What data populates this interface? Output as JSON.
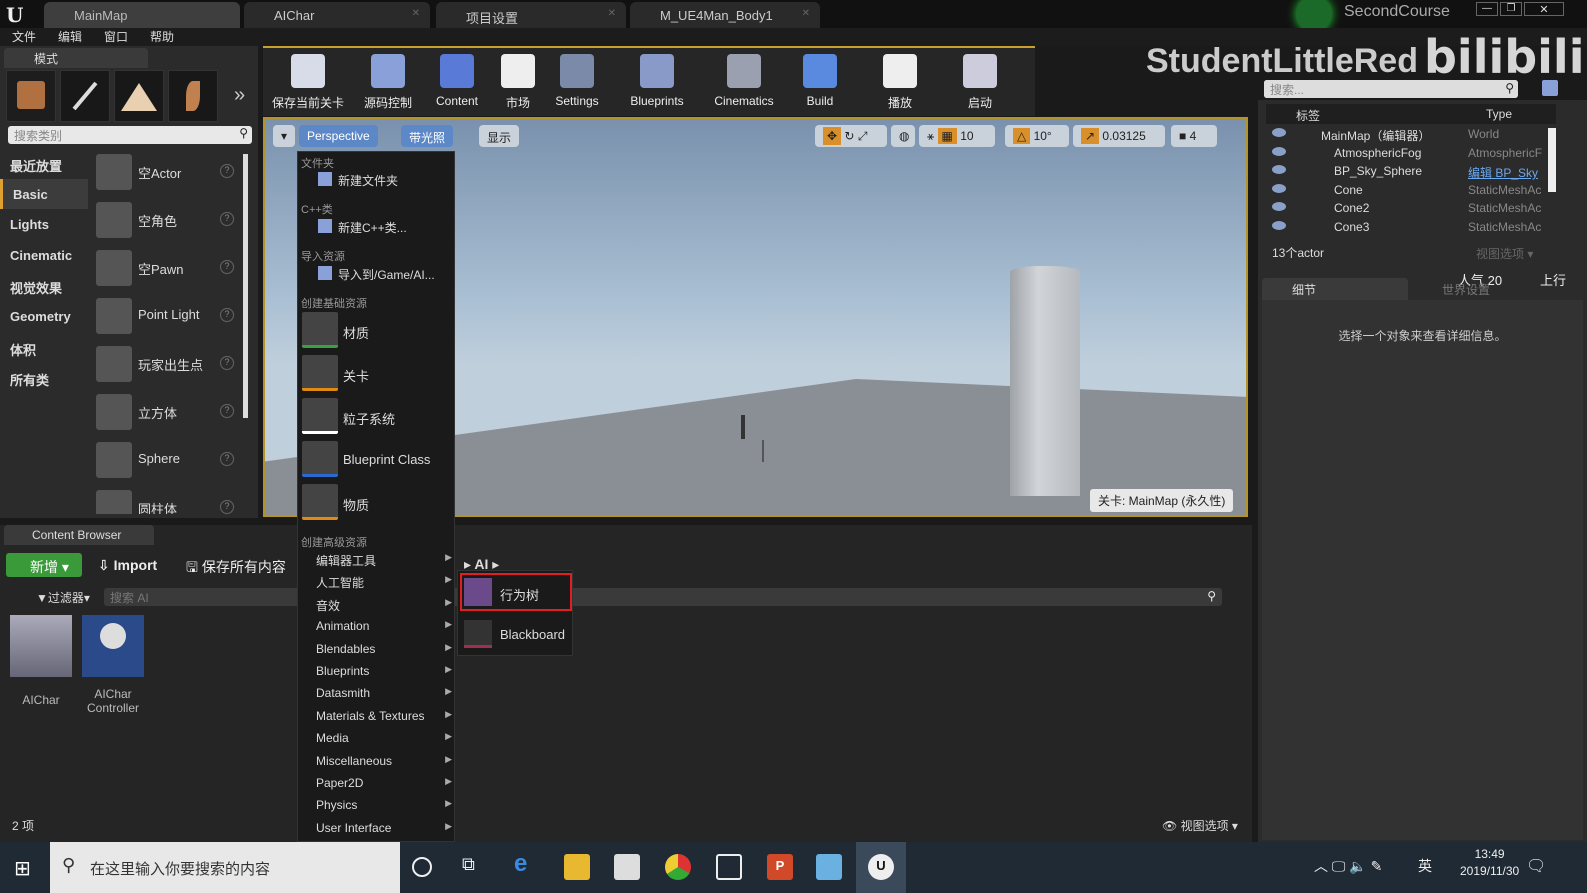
{
  "titlebar": {
    "tabs": [
      "MainMap",
      "AIChar",
      "项目设置",
      "M_UE4Man_Body1"
    ],
    "project": "SecondCourse"
  },
  "watermark": {
    "text": "StudentLittleRed",
    "logo": "bilibili"
  },
  "menu": [
    "文件",
    "编辑",
    "窗口",
    "帮助"
  ],
  "modes": {
    "tab": "模式",
    "search_placeholder": "搜索类别",
    "categories": [
      "最近放置",
      "Basic",
      "Lights",
      "Cinematic",
      "视觉效果",
      "Geometry",
      "体积",
      "所有类"
    ],
    "selected_category": "Basic",
    "items": [
      "空Actor",
      "空角色",
      "空Pawn",
      "Point Light",
      "玩家出生点",
      "立方体",
      "Sphere",
      "圆柱体"
    ]
  },
  "toolbar": [
    "保存当前关卡",
    "源码控制",
    "Content",
    "市场",
    "Settings",
    "Blueprints",
    "Cinematics",
    "Build",
    "播放",
    "启动"
  ],
  "viewport": {
    "perspective": "Perspective",
    "lit": "带光照",
    "show": "显示",
    "grid": "10",
    "rot": "10°",
    "scale": "0.03125",
    "camspeed": "4",
    "level": "关卡: MainMap (永久性)"
  },
  "outliner": {
    "search_placeholder": "搜索...",
    "col_label": "标签",
    "col_type": "Type",
    "rows": [
      {
        "name": "MainMap（编辑器）",
        "type": "World"
      },
      {
        "name": "AtmosphericFog",
        "type": "AtmosphericF"
      },
      {
        "name": "BP_Sky_Sphere",
        "type": "编辑 BP_Sky"
      },
      {
        "name": "Cone",
        "type": "StaticMeshAc"
      },
      {
        "name": "Cone2",
        "type": "StaticMeshAc"
      },
      {
        "name": "Cone3",
        "type": "StaticMeshAc"
      }
    ],
    "count": "13个actor",
    "view_options": "视图选项"
  },
  "overlay": {
    "popularity": "人气 20",
    "rank": "上行"
  },
  "details": {
    "tab": "细节",
    "world_tab": "世界设置",
    "empty": "选择一个对象来查看详细信息。"
  },
  "content_browser": {
    "tab": "Content Browser",
    "new": "新增",
    "import": "Import",
    "save_all": "保存所有内容",
    "filters": "过滤器",
    "search_placeholder": "搜索 AI",
    "path": "AI",
    "assets": [
      "AIChar",
      "AIChar Controller"
    ],
    "count": "2 项",
    "view_options": "视图选项"
  },
  "context_menu": {
    "sections": [
      "文件夹",
      "C++类",
      "导入资源",
      "创建基础资源",
      "创建高级资源"
    ],
    "new_folder": "新建文件夹",
    "new_cpp": "新建C++类...",
    "import_to": "导入到/Game/AI...",
    "basic": [
      {
        "label": "材质",
        "color": "#3aa040"
      },
      {
        "label": "关卡",
        "color": "#e08a10"
      },
      {
        "label": "粒子系统",
        "color": "#ffffff"
      },
      {
        "label": "Blueprint Class",
        "color": "#2a6ad0"
      },
      {
        "label": "物质",
        "color": "#e08a10"
      }
    ],
    "advanced": [
      "编辑器工具",
      "人工智能",
      "音效",
      "Animation",
      "Blendables",
      "Blueprints",
      "Datasmith",
      "Materials & Textures",
      "Media",
      "Miscellaneous",
      "Paper2D",
      "Physics",
      "User Interface"
    ]
  },
  "submenu": {
    "items": [
      "行为树",
      "Blackboard"
    ],
    "highlight_color": "#e02020"
  },
  "taskbar": {
    "search_placeholder": "在这里输入你要搜索的内容",
    "ime": "英",
    "time": "13:49",
    "date": "2019/11/30"
  }
}
